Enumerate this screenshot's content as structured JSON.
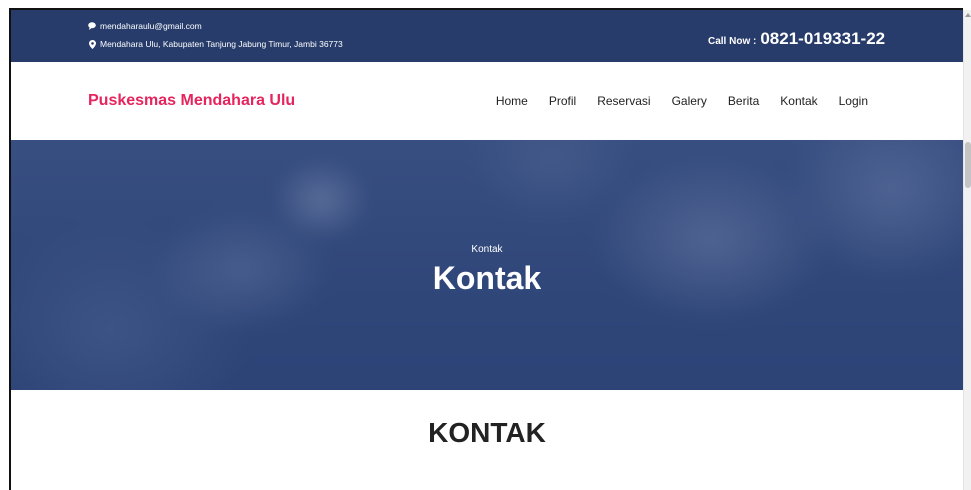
{
  "topbar": {
    "email_icon": "email-icon",
    "email": "mendaharaulu@gmail.com",
    "address_icon": "map-marker-icon",
    "address": "Mendahara Ulu, Kabupaten Tanjung Jabung Timur, Jambi 36773",
    "call_label": "Call Now :",
    "phone": "0821-019331-22"
  },
  "navbar": {
    "brand": "Puskesmas Mendahara Ulu",
    "menu": [
      "Home",
      "Profil",
      "Reservasi",
      "Galery",
      "Berita",
      "Kontak",
      "Login"
    ]
  },
  "hero": {
    "breadcrumb": "Kontak",
    "title": "Kontak"
  },
  "section": {
    "heading": "KONTAK"
  },
  "colors": {
    "topbar_bg": "#273c6b",
    "brand": "#e6245e",
    "heading": "#222222",
    "menu_text": "#222222",
    "hero_base": "#3a5284"
  }
}
